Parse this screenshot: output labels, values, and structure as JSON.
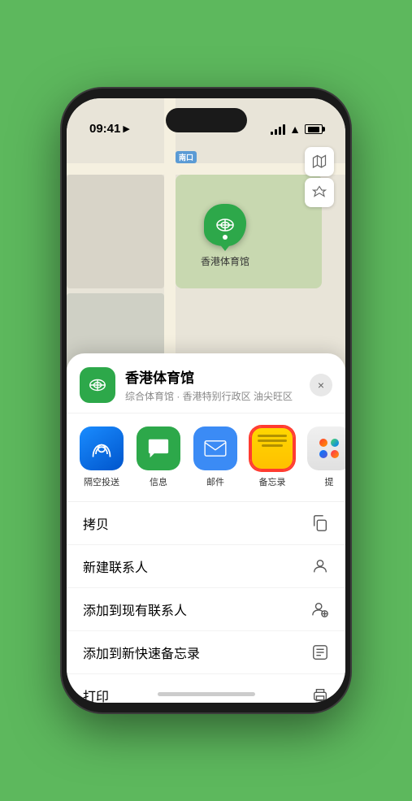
{
  "status_bar": {
    "time": "09:41",
    "location_icon": "▶"
  },
  "map": {
    "road_badge": "南口",
    "road_badge_prefix": "⊡",
    "stadium_name": "香港体育馆",
    "map_type_icon": "🗺",
    "location_icon": "⊳"
  },
  "venue_card": {
    "name": "香港体育馆",
    "subtitle": "综合体育馆 · 香港特别行政区 油尖旺区",
    "close_label": "×"
  },
  "share_row": [
    {
      "id": "airdrop",
      "label": "隔空投送",
      "icon_type": "airdrop"
    },
    {
      "id": "message",
      "label": "信息",
      "icon_type": "message"
    },
    {
      "id": "mail",
      "label": "邮件",
      "icon_type": "mail"
    },
    {
      "id": "notes",
      "label": "备忘录",
      "icon_type": "notes"
    },
    {
      "id": "more",
      "label": "提",
      "icon_type": "more"
    }
  ],
  "actions": [
    {
      "id": "copy",
      "label": "拷贝",
      "icon": "⧉"
    },
    {
      "id": "new-contact",
      "label": "新建联系人",
      "icon": "👤"
    },
    {
      "id": "add-existing",
      "label": "添加到现有联系人",
      "icon": "👤"
    },
    {
      "id": "add-notes",
      "label": "添加到新快速备忘录",
      "icon": "⊡"
    },
    {
      "id": "print",
      "label": "打印",
      "icon": "🖨"
    }
  ],
  "colors": {
    "green": "#2da84a",
    "blue": "#3b8bf5",
    "red": "#ff3b30",
    "notes_yellow": "#ffd700"
  }
}
